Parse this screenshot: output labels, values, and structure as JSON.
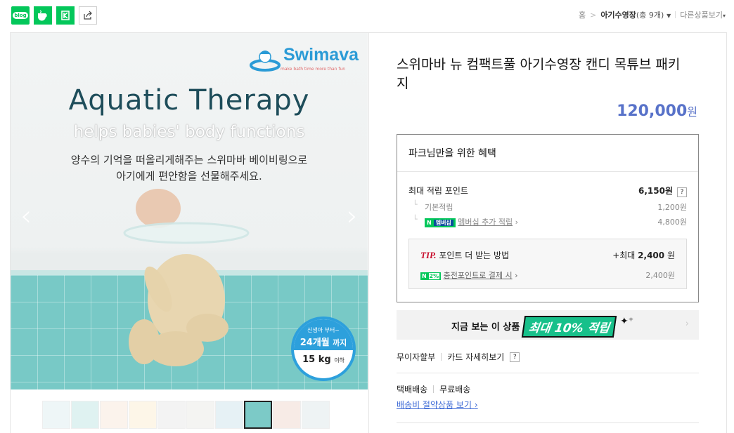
{
  "share_bar": {
    "blog_label": "blog",
    "icons": [
      "blog-icon",
      "cafe-icon",
      "kakao-page-icon",
      "share-icon"
    ]
  },
  "breadcrumb": {
    "home": "홈",
    "separator": ">",
    "current": "아기수영장",
    "count": "(총 9개)",
    "other": "다른상품보기"
  },
  "hero": {
    "logo": "Swimava",
    "logo_tagline": "make bath time more than fun",
    "title": "Aquatic Therapy",
    "subtitle": "helps babies' body functions",
    "desc_line1": "양수의 기억을 떠올리게해주는 스위마바 베이비링으로",
    "desc_line2": "아기에게 편안함을 선물해주세요.",
    "badge_top": "신생아 부터~",
    "badge_main": "24개월",
    "badge_main_suffix": "까지",
    "badge_weight": "15 kg",
    "badge_weight_suffix": "이하",
    "prev_arrow": "‹",
    "next_arrow": "›"
  },
  "thumbnails": {
    "count": 10,
    "active_index": 7
  },
  "product": {
    "name": "스위마바 뉴 컴팩트풀 아기수영장 캔디 목튜브 패키지",
    "price": "120,000",
    "currency": "원"
  },
  "benefit": {
    "title": "파크님만을 위한 혜택",
    "max_points_label": "최대 적립 포인트",
    "max_points_value": "6,150원",
    "help": "?",
    "basic_label": "기본적립",
    "basic_value": "1,200원",
    "membership_pill": "N",
    "membership_pill_b": "멤버십",
    "membership_label": "멤버십 추가 적립",
    "membership_value": "4,800원",
    "tip_label": "TIP.",
    "tip_text": "포인트 더 받는 방법",
    "tip_value_prefix": "+최대",
    "tip_value": "2,400",
    "tip_value_unit": "원",
    "charge_pill": "N",
    "charge_pct": "2%",
    "charge_label": "충전포인트로 결제 시",
    "charge_value": "2,400원"
  },
  "promo": {
    "text": "지금 보는 이 상품",
    "highlight": "최대 10% 적립"
  },
  "payment": {
    "installment": "무이자할부",
    "card_detail": "카드 자세히보기",
    "help": "?"
  },
  "shipping": {
    "method": "택배배송",
    "fee": "무료배송",
    "link": "배송비 절약상품 보기"
  }
}
